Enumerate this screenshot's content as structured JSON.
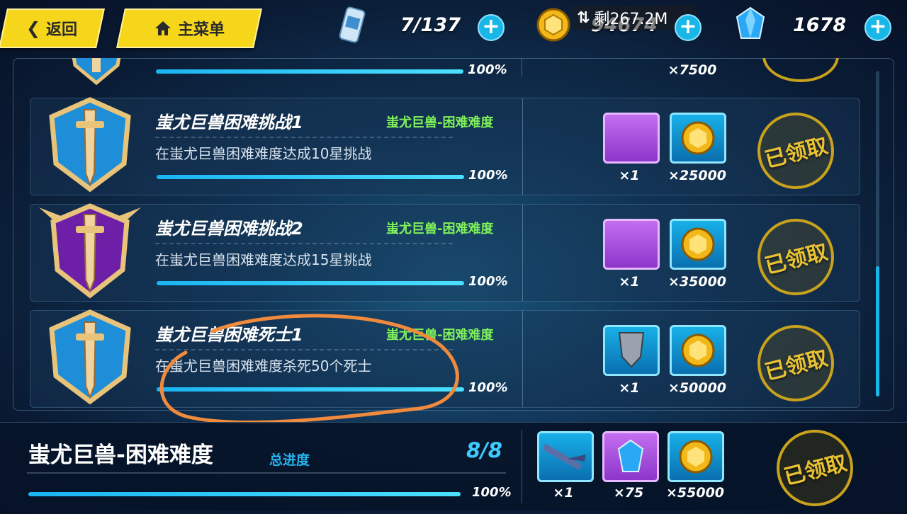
{
  "topbar": {
    "back_label": "返回",
    "menu_label": "主菜单",
    "stamina": "7/137",
    "coins": "94674",
    "crystals": "1678",
    "overlay": "剩267.2M"
  },
  "partial_row": {
    "progress": "100%",
    "reward_qty": "×7500"
  },
  "achievements": [
    {
      "title": "蚩尤巨兽困难挑战1",
      "tag": "蚩尤巨兽-困难难度",
      "desc": "在蚩尤巨兽困难难度达成10星挑战",
      "progress": "100%",
      "reward1_qty": "×1",
      "reward2_qty": "×25000",
      "status": "已领取"
    },
    {
      "title": "蚩尤巨兽困难挑战2",
      "tag": "蚩尤巨兽-困难难度",
      "desc": "在蚩尤巨兽困难难度达成15星挑战",
      "progress": "100%",
      "reward1_qty": "×1",
      "reward2_qty": "×35000",
      "status": "已领取"
    },
    {
      "title": "蚩尤巨兽困难死士1",
      "tag": "蚩尤巨兽-困难难度",
      "desc": "在蚩尤巨兽困难难度杀死50个死士",
      "progress": "100%",
      "reward1_qty": "×1",
      "reward2_qty": "×50000",
      "status": "已领取"
    }
  ],
  "summary": {
    "title": "蚩尤巨兽-困难难度",
    "label": "总进度",
    "count": "8/8",
    "progress": "100%",
    "reward1_qty": "×1",
    "reward2_qty": "×75",
    "reward3_qty": "×55000",
    "status": "已领取"
  },
  "colors": {
    "accent": "#f5d61b",
    "tag_green": "#7ff05b",
    "bar_blue": "#1ab4f2",
    "annotation": "#f08a3c"
  }
}
